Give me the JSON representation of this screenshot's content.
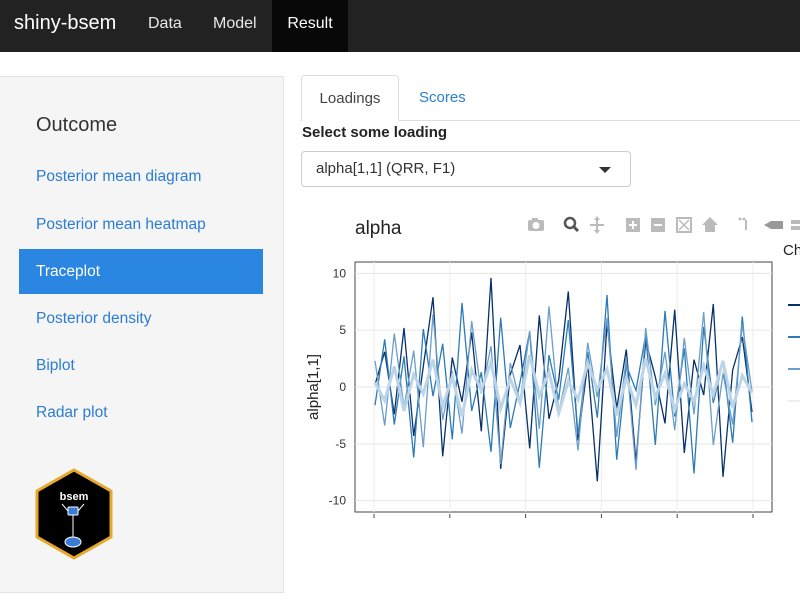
{
  "navbar": {
    "brand": "shiny-bsem",
    "items": [
      "Data",
      "Model",
      "Result"
    ],
    "active": "Result"
  },
  "sidebar": {
    "title": "Outcome",
    "items": [
      "Posterior mean diagram",
      "Posterior mean heatmap",
      "Traceplot",
      "Posterior density",
      "Biplot",
      "Radar plot"
    ],
    "active": "Traceplot",
    "logo_text": "bsem"
  },
  "tabs": {
    "items": [
      "Loadings",
      "Scores"
    ],
    "active": "Loadings"
  },
  "loading_select": {
    "label": "Select some loading",
    "value": "alpha[1,1] (QRR, F1)"
  },
  "chart_data": {
    "type": "line",
    "title": "alpha",
    "ylabel": "alpha[1,1]",
    "ylim": [
      -11,
      11
    ],
    "yticks": [
      10,
      5,
      0,
      -5,
      -10
    ],
    "legend_title": "Ch",
    "grid": true,
    "legend": "right",
    "colors": [
      "#08306b",
      "#2c7bb6",
      "#6b9ec9",
      "#bcd4e8"
    ],
    "series": [
      {
        "values": [
          0.2,
          3.1,
          -2.4,
          5.2,
          -4.3,
          1.8,
          7.9,
          -6.1,
          2.6,
          -1.3,
          4.8,
          -3.9,
          9.6,
          -7.2,
          1.1,
          3.7,
          -5.4,
          6.3,
          -2.8,
          0.6,
          8.4,
          -4.7,
          2.1,
          -8.3,
          5.6,
          -1.9,
          3.3,
          -6.6,
          4.1,
          0.9,
          -3.2,
          6.8,
          -5.8,
          2.4,
          -0.7,
          7.3,
          -7.9,
          1.5,
          4.4,
          -2.2
        ]
      },
      {
        "values": [
          -1.6,
          4.2,
          -3.3,
          2.7,
          -6.2,
          5.1,
          -0.8,
          3.8,
          -4.6,
          7.4,
          -2.1,
          1.3,
          -5.7,
          6.1,
          -3.6,
          0.4,
          4.9,
          -7.1,
          2.8,
          -1.1,
          5.9,
          -4.2,
          3.1,
          -2.7,
          8.1,
          -6.4,
          1.9,
          -0.3,
          4.6,
          -5.1,
          6.7,
          -2.6,
          3.4,
          -7.6,
          5.3,
          -1.4,
          2.2,
          -4.9,
          6.2,
          -3.1
        ]
      },
      {
        "values": [
          2.3,
          -3.4,
          4.7,
          -1.8,
          3.2,
          -5.3,
          6.4,
          -2.9,
          1.4,
          -4.1,
          5.8,
          -0.6,
          3.6,
          -6.8,
          2.1,
          -1.3,
          4.9,
          -3.7,
          7.1,
          -2.2,
          1.7,
          -5.6,
          3.9,
          -0.9,
          6.1,
          -4.4,
          2.5,
          -7.3,
          5.2,
          -1.6,
          3.1,
          -3.8,
          4.3,
          -2.4,
          6.6,
          -5.1,
          1.2,
          -3.3,
          5.5,
          -0.4
        ]
      },
      {
        "values": [
          0.4,
          -1.2,
          1.8,
          -2.1,
          1.1,
          -0.6,
          2.4,
          -1.7,
          0.9,
          -2.6,
          1.5,
          -0.3,
          2.2,
          -1.9,
          0.7,
          -1.4,
          2.8,
          -0.8,
          1.3,
          -2.3,
          0.5,
          -1.1,
          2.1,
          -0.2,
          1.6,
          -2.5,
          0.8,
          -1.6,
          2.5,
          -0.9,
          1.2,
          -2.0,
          0.3,
          -1.3,
          1.9,
          -0.7,
          2.3,
          -1.8,
          1.0,
          -0.5
        ]
      }
    ]
  },
  "modebar_icons": [
    "camera-icon",
    "zoom-icon",
    "pan-icon",
    "zoom-in-icon",
    "zoom-out-icon",
    "autoscale-icon",
    "home-icon",
    "spike-icon",
    "hover-closest-icon",
    "hover-compare-icon"
  ]
}
